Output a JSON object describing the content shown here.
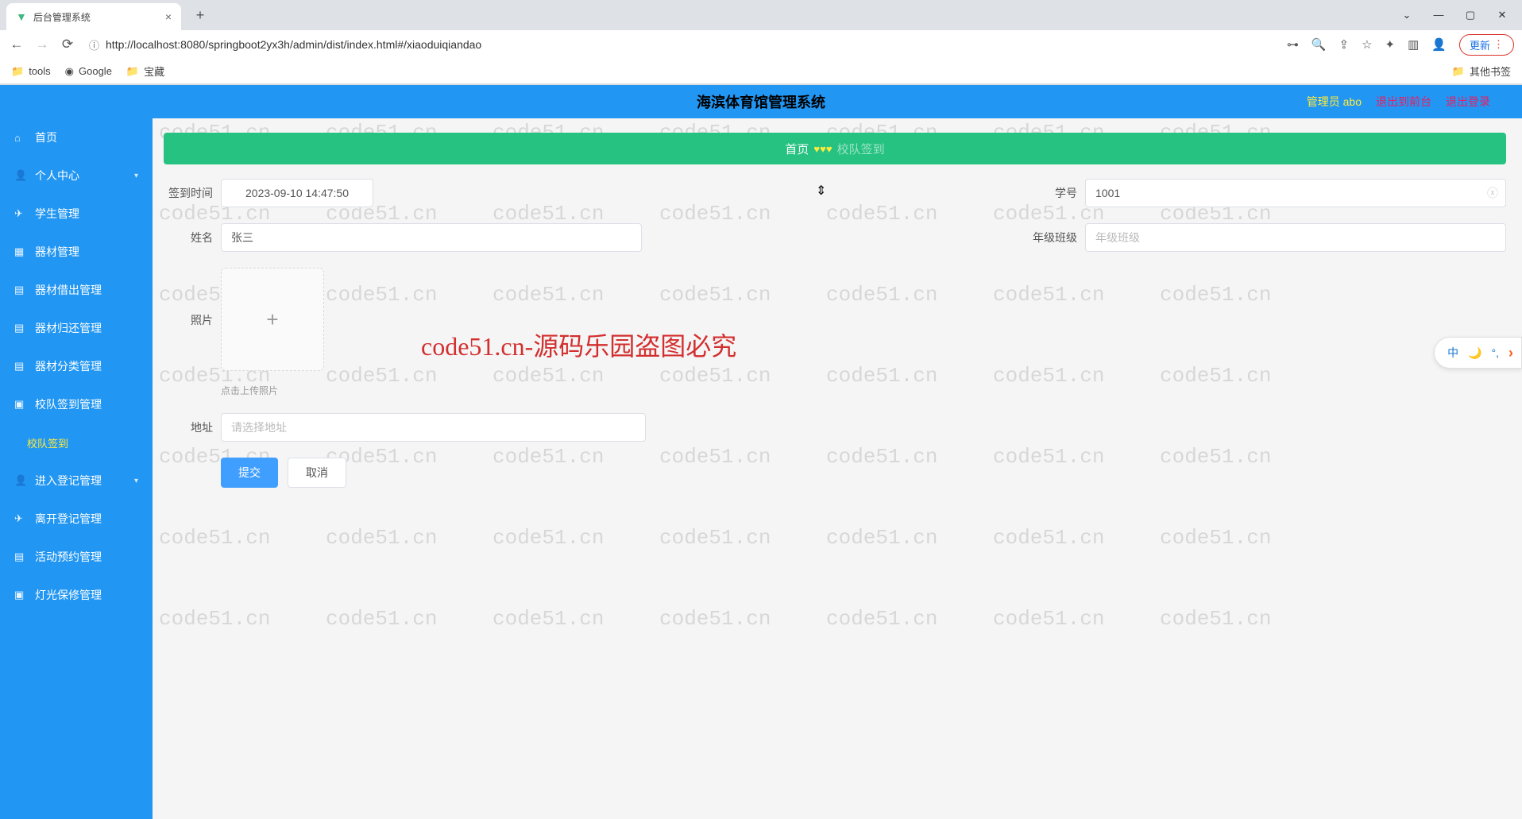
{
  "browser": {
    "tab_title": "后台管理系统",
    "url": "http://localhost:8080/springboot2yx3h/admin/dist/index.html#/xiaoduiqiandao",
    "update_btn": "更新",
    "bookmarks": {
      "tools": "tools",
      "google": "Google",
      "treasure": "宝藏",
      "other": "其他书签"
    }
  },
  "header": {
    "title": "海滨体育馆管理系统",
    "admin": "管理员 abo",
    "to_front": "退出到前台",
    "logout": "退出登录"
  },
  "sidebar": {
    "items": [
      {
        "icon": "⌂",
        "label": "首页"
      },
      {
        "icon": "👤",
        "label": "个人中心",
        "arrow": true
      },
      {
        "icon": "✈",
        "label": "学生管理"
      },
      {
        "icon": "▦",
        "label": "器材管理"
      },
      {
        "icon": "▤",
        "label": "器材借出管理"
      },
      {
        "icon": "▤",
        "label": "器材归还管理"
      },
      {
        "icon": "▤",
        "label": "器材分类管理"
      },
      {
        "icon": "▣",
        "label": "校队签到管理"
      },
      {
        "icon": "",
        "label": "校队签到",
        "sub": true
      },
      {
        "icon": "👤",
        "label": "进入登记管理",
        "arrow": true
      },
      {
        "icon": "✈",
        "label": "离开登记管理"
      },
      {
        "icon": "▤",
        "label": "活动预约管理"
      },
      {
        "icon": "▣",
        "label": "灯光保修管理"
      }
    ]
  },
  "breadcrumb": {
    "home": "首页",
    "current": "校队签到"
  },
  "form": {
    "checkin_time_label": "签到时间",
    "checkin_time_value": "2023-09-10 14:47:50",
    "student_id_label": "学号",
    "student_id_value": "1001",
    "name_label": "姓名",
    "name_value": "张三",
    "class_label": "年级班级",
    "class_placeholder": "年级班级",
    "photo_label": "照片",
    "photo_hint": "点击上传照片",
    "address_label": "地址",
    "address_placeholder": "请选择地址",
    "submit": "提交",
    "cancel": "取消"
  },
  "watermark": {
    "text": "code51.cn",
    "center": "code51.cn-源码乐园盗图必究"
  },
  "side_tool": {
    "cn": "中",
    "moon": "🌙",
    "comma": "，",
    "arrow": "›"
  }
}
